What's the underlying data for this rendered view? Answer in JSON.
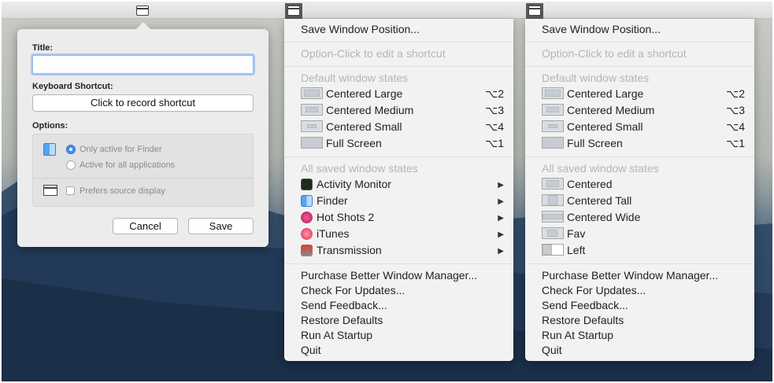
{
  "popover": {
    "title_label": "Title:",
    "title_value": "",
    "shortcut_label": "Keyboard Shortcut:",
    "shortcut_button": "Click to record shortcut",
    "options_label": "Options:",
    "radio_finder": "Only active for Finder",
    "radio_all": "Active for all applications",
    "prefers_source": "Prefers source display",
    "cancel": "Cancel",
    "save": "Save"
  },
  "menu1": {
    "save_position": "Save Window Position...",
    "option_click": "Option-Click to edit a shortcut",
    "default_header": "Default window states",
    "defaults": [
      {
        "label": "Centered Large",
        "shortcut": "⌥2"
      },
      {
        "label": "Centered Medium",
        "shortcut": "⌥3"
      },
      {
        "label": "Centered Small",
        "shortcut": "⌥4"
      },
      {
        "label": "Full Screen",
        "shortcut": "⌥1"
      }
    ],
    "saved_header": "All saved window states",
    "apps": [
      {
        "label": "Activity Monitor",
        "icon": "activity-monitor-icon"
      },
      {
        "label": "Finder",
        "icon": "finder-icon"
      },
      {
        "label": "Hot Shots 2",
        "icon": "hot-shots-icon"
      },
      {
        "label": "iTunes",
        "icon": "itunes-icon"
      },
      {
        "label": "Transmission",
        "icon": "transmission-icon"
      }
    ],
    "footer": [
      "Purchase Better Window Manager...",
      "Check For Updates...",
      "Send Feedback...",
      "Restore Defaults",
      "Run At Startup",
      "Quit"
    ]
  },
  "menu2": {
    "save_position": "Save Window Position...",
    "option_click": "Option-Click to edit a shortcut",
    "default_header": "Default window states",
    "defaults": [
      {
        "label": "Centered Large",
        "shortcut": "⌥2"
      },
      {
        "label": "Centered Medium",
        "shortcut": "⌥3"
      },
      {
        "label": "Centered Small",
        "shortcut": "⌥4"
      },
      {
        "label": "Full Screen",
        "shortcut": "⌥1"
      }
    ],
    "saved_header": "All saved window states",
    "saved": [
      "Centered",
      "Centered Tall",
      "Centered Wide",
      "Fav",
      "Left"
    ],
    "footer": [
      "Purchase Better Window Manager...",
      "Check For Updates...",
      "Send Feedback...",
      "Restore Defaults",
      "Run At Startup",
      "Quit"
    ]
  },
  "colors": {
    "accent": "#3f8ef6",
    "menu_bg": "#f2f2f2",
    "disabled_text": "#b5b5b5"
  },
  "submenu_arrow": "▶"
}
